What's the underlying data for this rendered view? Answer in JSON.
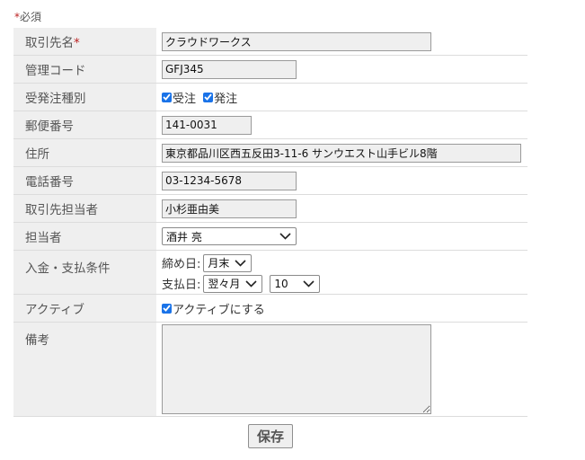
{
  "required_note": {
    "mark": "*",
    "text": "必須"
  },
  "form": {
    "partner_name": {
      "label": "取引先名",
      "required_mark": "*",
      "value": "クラウドワークス"
    },
    "management_code": {
      "label": "管理コード",
      "value": "GFJ345"
    },
    "order_type": {
      "label": "受発注種別",
      "options": [
        {
          "label": "受注",
          "checked": true
        },
        {
          "label": "発注",
          "checked": true
        }
      ]
    },
    "postal_code": {
      "label": "郵便番号",
      "value": "141-0031"
    },
    "address": {
      "label": "住所",
      "value": "東京都品川区西五反田3-11-6 サンウエスト山手ビル8階"
    },
    "phone": {
      "label": "電話番号",
      "value": "03-1234-5678"
    },
    "partner_contact": {
      "label": "取引先担当者",
      "value": "小杉亜由美"
    },
    "staff": {
      "label": "担当者",
      "selected": "酒井 亮"
    },
    "payment_terms": {
      "label": "入金・支払条件",
      "closing_label": "締め日:",
      "closing_selected": "月末",
      "payment_label": "支払日:",
      "payment_month_selected": "翌々月",
      "payment_day_selected": "10"
    },
    "active": {
      "label": "アクティブ",
      "checkbox_label": "アクティブにする",
      "checked": true
    },
    "remarks": {
      "label": "備考",
      "value": ""
    }
  },
  "save_button": {
    "label": "保存"
  },
  "colors": {
    "checkbox": "#1a73e8",
    "required": "#b22222",
    "label_bg": "#efefef"
  }
}
